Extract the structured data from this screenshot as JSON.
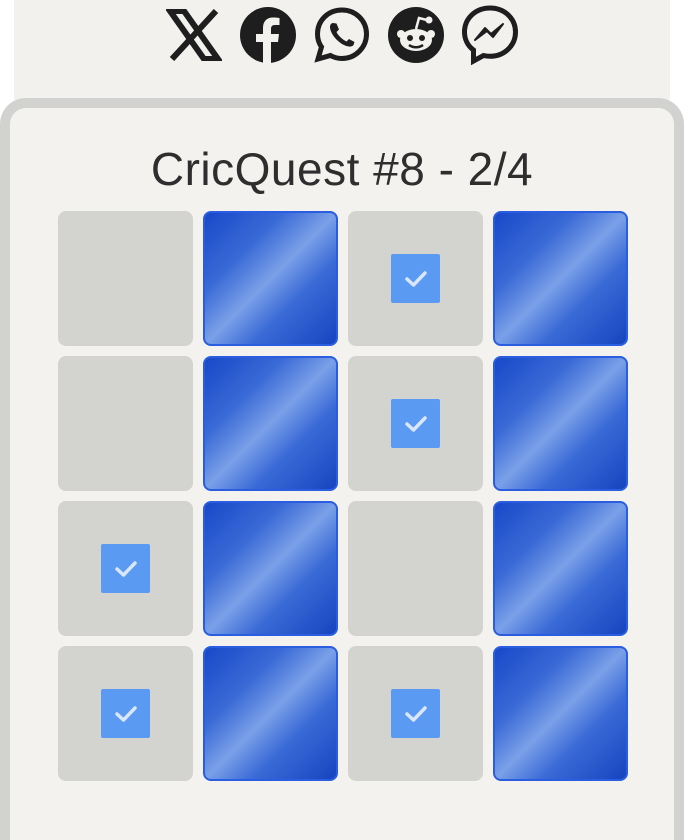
{
  "share": {
    "buttons": [
      {
        "name": "x-share-button",
        "icon": "x-icon"
      },
      {
        "name": "facebook-share-button",
        "icon": "facebook-icon"
      },
      {
        "name": "whatsapp-share-button",
        "icon": "whatsapp-icon"
      },
      {
        "name": "reddit-share-button",
        "icon": "reddit-icon"
      },
      {
        "name": "messenger-share-button",
        "icon": "messenger-icon"
      }
    ]
  },
  "result": {
    "title": "CricQuest #8 - 2/4"
  },
  "grid": {
    "rows": [
      [
        "empty",
        "filled",
        "checked",
        "filled"
      ],
      [
        "empty",
        "filled",
        "checked",
        "filled"
      ],
      [
        "checked",
        "filled",
        "empty",
        "filled"
      ],
      [
        "checked",
        "filled",
        "checked",
        "filled"
      ]
    ]
  },
  "colors": {
    "tile_empty": "#d3d3cf",
    "tile_filled": "#2a5de0",
    "check_box": "#5b9af2",
    "card_bg": "#f3f2ee",
    "card_border": "#d2d2d0"
  }
}
